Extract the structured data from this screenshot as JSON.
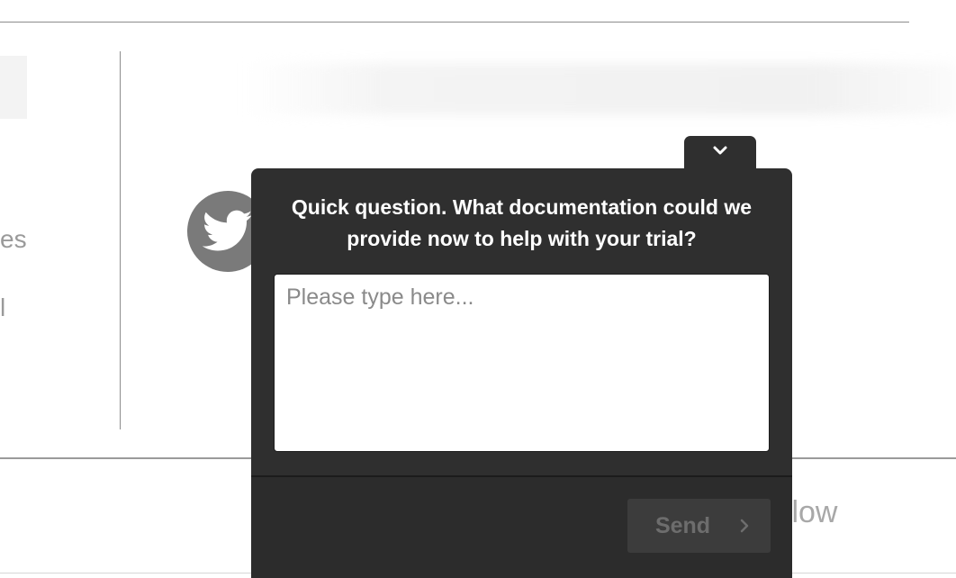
{
  "background": {
    "left_text_line1": "es",
    "left_text_line2": "l",
    "footer_logo_text": "flow"
  },
  "widget": {
    "question": "Quick question. What documentation could we provide now to help with your trial?",
    "input_placeholder": "Please type here...",
    "input_value": "",
    "send_label": "Send",
    "collapse_icon": "chevron-down-icon",
    "send_icon": "chevron-right-icon"
  },
  "colors": {
    "widget_bg": "#2f2f2f",
    "send_button_bg": "#3c3c3c",
    "send_text": "#6d6d6d",
    "twitter_circle": "#7a7a7a"
  }
}
